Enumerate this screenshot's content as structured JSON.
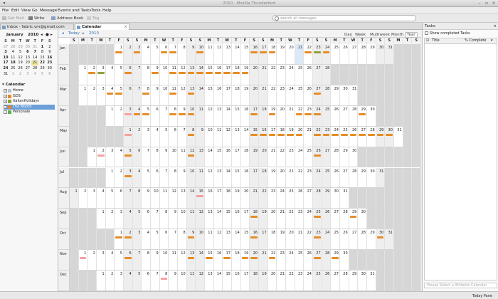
{
  "window": {
    "title": "2010 - Mozilla Thunderbird"
  },
  "menubar": [
    "File",
    "Edit",
    "View",
    "Go",
    "Message",
    "Events and Tasks",
    "Tools",
    "Help"
  ],
  "toolbar": {
    "get_mail": "Get Mail",
    "write": "Write",
    "address_book": "Address Book",
    "tag": "Tag"
  },
  "search": {
    "placeholder": "search all messages"
  },
  "tabs": [
    {
      "label": "Inbox - fabric.vm@gmail.com"
    },
    {
      "label": "Calendar"
    }
  ],
  "minimonth": {
    "title": "January",
    "year": "2010",
    "weekdays": [
      "S",
      "M",
      "T",
      "W",
      "T",
      "F",
      "S"
    ],
    "weeks": [
      [
        "27",
        "28",
        "29",
        "30",
        "31",
        "1",
        "2"
      ],
      [
        "3",
        "4",
        "5",
        "6",
        "7",
        "8",
        "9"
      ],
      [
        "10",
        "11",
        "12",
        "13",
        "14",
        "15",
        "16"
      ],
      [
        "17",
        "18",
        "19",
        "20",
        "21",
        "22",
        "23"
      ],
      [
        "24",
        "25",
        "26",
        "27",
        "28",
        "29",
        "30"
      ],
      [
        "31",
        "1",
        "2",
        "3",
        "4",
        "5",
        "6"
      ]
    ]
  },
  "calendars": {
    "title": "Calendar",
    "items": [
      {
        "label": "Home",
        "color": "#b9c3d0",
        "checked": true
      },
      {
        "label": "GDS",
        "color": "#e68c26",
        "checked": true
      },
      {
        "label": "ItalianHolidays",
        "color": "#8fa33b",
        "checked": true
      },
      {
        "label": "The Month",
        "color": "#e67e32",
        "checked": true,
        "selected": true
      },
      {
        "label": "Personale",
        "color": "#5fb04f",
        "checked": false
      }
    ]
  },
  "nav": {
    "today": "Today",
    "year": "2010"
  },
  "views": [
    "Day",
    "Week",
    "Multiweek",
    "Month",
    "Year"
  ],
  "weekday_header": [
    "S",
    "M",
    "T",
    "W",
    "T",
    "F",
    "S",
    "S",
    "M",
    "T",
    "W",
    "T",
    "F",
    "S",
    "S",
    "M",
    "T",
    "W",
    "T",
    "F",
    "S",
    "S",
    "M",
    "T",
    "W",
    "T",
    "F",
    "S",
    "S",
    "M",
    "T",
    "W",
    "T",
    "F",
    "S",
    "S",
    "M",
    "T",
    "S"
  ],
  "months": [
    {
      "label": "Jan",
      "offset": 5,
      "days": 31
    },
    {
      "label": "Feb",
      "offset": 1,
      "days": 28
    },
    {
      "label": "Mar",
      "offset": 1,
      "days": 31
    },
    {
      "label": "Apr",
      "offset": 4,
      "days": 30
    },
    {
      "label": "May",
      "offset": 6,
      "days": 31
    },
    {
      "label": "Jun",
      "offset": 2,
      "days": 30
    },
    {
      "label": "Jul",
      "offset": 4,
      "days": 31
    },
    {
      "label": "Aug",
      "offset": 0,
      "days": 31
    },
    {
      "label": "Sep",
      "offset": 3,
      "days": 30
    },
    {
      "label": "Oct",
      "offset": 5,
      "days": 31
    },
    {
      "label": "Nov",
      "offset": 1,
      "days": 30
    },
    {
      "label": "Dec",
      "offset": 3,
      "days": 31
    }
  ],
  "events": [
    {
      "m": 0,
      "d": 1,
      "c": "#e68c26"
    },
    {
      "m": 0,
      "d": 3,
      "c": "#e68c26"
    },
    {
      "m": 0,
      "d": 6,
      "c": "#e68c26"
    },
    {
      "m": 0,
      "d": 7,
      "c": "#e68c26"
    },
    {
      "m": 0,
      "d": 10,
      "c": "#e68c26"
    },
    {
      "m": 0,
      "d": 16,
      "c": "#e68c26"
    },
    {
      "m": 0,
      "d": 17,
      "c": "#e68c26"
    },
    {
      "m": 0,
      "d": 18,
      "c": "#e68c26"
    },
    {
      "m": 0,
      "d": 22,
      "c": "#e68c26"
    },
    {
      "m": 0,
      "d": 23,
      "c": "#8fa33b"
    },
    {
      "m": 0,
      "d": 24,
      "c": "#e68c26"
    },
    {
      "m": 1,
      "d": 2,
      "c": "#e68c26"
    },
    {
      "m": 1,
      "d": 3,
      "c": "#8fa33b"
    },
    {
      "m": 1,
      "d": 6,
      "c": "#e68c26"
    },
    {
      "m": 1,
      "d": 9,
      "c": "#e68c26"
    },
    {
      "m": 1,
      "d": 11,
      "c": "#e68c26"
    },
    {
      "m": 1,
      "d": 12,
      "c": "#e68c26"
    },
    {
      "m": 1,
      "d": 13,
      "c": "#e68c26"
    },
    {
      "m": 1,
      "d": 14,
      "c": "#e68c26"
    },
    {
      "m": 1,
      "d": 15,
      "c": "#e68c26"
    },
    {
      "m": 1,
      "d": 16,
      "c": "#e68c26"
    },
    {
      "m": 1,
      "d": 17,
      "c": "#e68c26"
    },
    {
      "m": 1,
      "d": 18,
      "c": "#e68c26"
    },
    {
      "m": 1,
      "d": 19,
      "c": "#e68c26"
    },
    {
      "m": 2,
      "d": 4,
      "c": "#e68c26"
    },
    {
      "m": 2,
      "d": 5,
      "c": "#e68c26"
    },
    {
      "m": 2,
      "d": 8,
      "c": "#e68c26"
    },
    {
      "m": 2,
      "d": 11,
      "c": "#e68c26"
    },
    {
      "m": 2,
      "d": 13,
      "c": "#e68c26"
    },
    {
      "m": 2,
      "d": 27,
      "c": "#e68c26"
    },
    {
      "m": 3,
      "d": 3,
      "c": "#f3a0a0"
    },
    {
      "m": 3,
      "d": 4,
      "c": "#e68c26"
    },
    {
      "m": 3,
      "d": 5,
      "c": "#e68c26"
    },
    {
      "m": 3,
      "d": 8,
      "c": "#e68c26"
    },
    {
      "m": 3,
      "d": 9,
      "c": "#e68c26"
    },
    {
      "m": 3,
      "d": 10,
      "c": "#e68c26"
    },
    {
      "m": 3,
      "d": 17,
      "c": "#e68c26"
    },
    {
      "m": 3,
      "d": 19,
      "c": "#e68c26"
    },
    {
      "m": 3,
      "d": 22,
      "c": "#e68c26"
    },
    {
      "m": 3,
      "d": 23,
      "c": "#e68c26"
    },
    {
      "m": 3,
      "d": 24,
      "c": "#e68c26"
    },
    {
      "m": 3,
      "d": 29,
      "c": "#e68c26"
    },
    {
      "m": 4,
      "d": 1,
      "c": "#f3a0a0"
    },
    {
      "m": 4,
      "d": 8,
      "c": "#e68c26"
    },
    {
      "m": 4,
      "d": 15,
      "c": "#e68c26"
    },
    {
      "m": 4,
      "d": 16,
      "c": "#e68c26"
    },
    {
      "m": 4,
      "d": 17,
      "c": "#e68c26"
    },
    {
      "m": 4,
      "d": 18,
      "c": "#e68c26"
    },
    {
      "m": 4,
      "d": 19,
      "c": "#e68c26"
    },
    {
      "m": 4,
      "d": 20,
      "c": "#e68c26"
    },
    {
      "m": 4,
      "d": 22,
      "c": "#e68c26"
    },
    {
      "m": 4,
      "d": 23,
      "c": "#e68c26"
    },
    {
      "m": 4,
      "d": 24,
      "c": "#e68c26"
    },
    {
      "m": 4,
      "d": 25,
      "c": "#e68c26"
    },
    {
      "m": 4,
      "d": 26,
      "c": "#e68c26"
    },
    {
      "m": 4,
      "d": 27,
      "c": "#e68c26"
    },
    {
      "m": 4,
      "d": 28,
      "c": "#e68c26"
    },
    {
      "m": 4,
      "d": 29,
      "c": "#e68c26"
    },
    {
      "m": 4,
      "d": 30,
      "c": "#e68c26"
    },
    {
      "m": 5,
      "d": 2,
      "c": "#f3a0a0"
    },
    {
      "m": 5,
      "d": 5,
      "c": "#e68c26"
    },
    {
      "m": 5,
      "d": 12,
      "c": "#e68c26"
    },
    {
      "m": 5,
      "d": 26,
      "c": "#e68c26"
    },
    {
      "m": 6,
      "d": 3,
      "c": "#e68c26"
    },
    {
      "m": 7,
      "d": 15,
      "c": "#f3a0a0"
    },
    {
      "m": 8,
      "d": 18,
      "c": "#e68c26"
    },
    {
      "m": 8,
      "d": 25,
      "c": "#e68c26"
    },
    {
      "m": 8,
      "d": 29,
      "c": "#e68c26"
    },
    {
      "m": 9,
      "d": 1,
      "c": "#e68c26"
    },
    {
      "m": 9,
      "d": 2,
      "c": "#e68c26"
    },
    {
      "m": 9,
      "d": 9,
      "c": "#e68c26"
    },
    {
      "m": 9,
      "d": 16,
      "c": "#e68c26"
    },
    {
      "m": 9,
      "d": 23,
      "c": "#e68c26"
    },
    {
      "m": 9,
      "d": 30,
      "c": "#e68c26"
    },
    {
      "m": 10,
      "d": 1,
      "c": "#f3a0a0"
    },
    {
      "m": 10,
      "d": 6,
      "c": "#e68c26"
    },
    {
      "m": 10,
      "d": 13,
      "c": "#e68c26"
    },
    {
      "m": 10,
      "d": 15,
      "c": "#e68c26"
    },
    {
      "m": 10,
      "d": 17,
      "c": "#e68c26"
    },
    {
      "m": 10,
      "d": 19,
      "c": "#e68c26"
    },
    {
      "m": 10,
      "d": 20,
      "c": "#e68c26"
    },
    {
      "m": 10,
      "d": 22,
      "c": "#e68c26"
    },
    {
      "m": 10,
      "d": 27,
      "c": "#e68c26"
    },
    {
      "m": 10,
      "d": 29,
      "c": "#e68c26"
    },
    {
      "m": 11,
      "d": 8,
      "c": "#f3a0a0"
    }
  ],
  "tasks": {
    "title": "Tasks",
    "show_completed": "Show completed Tasks",
    "columns": {
      "title": "Title",
      "complete": "% Complete"
    },
    "new_task_placeholder": "Please Select a Writable Calendar"
  },
  "status": {
    "today_pane": "Today Pane"
  },
  "colors": {
    "selected": "#6a9fd8",
    "today": "#dbe8f6",
    "event": "#e68c26",
    "holiday": "#8fa33b",
    "birthday": "#f3a0a0"
  }
}
